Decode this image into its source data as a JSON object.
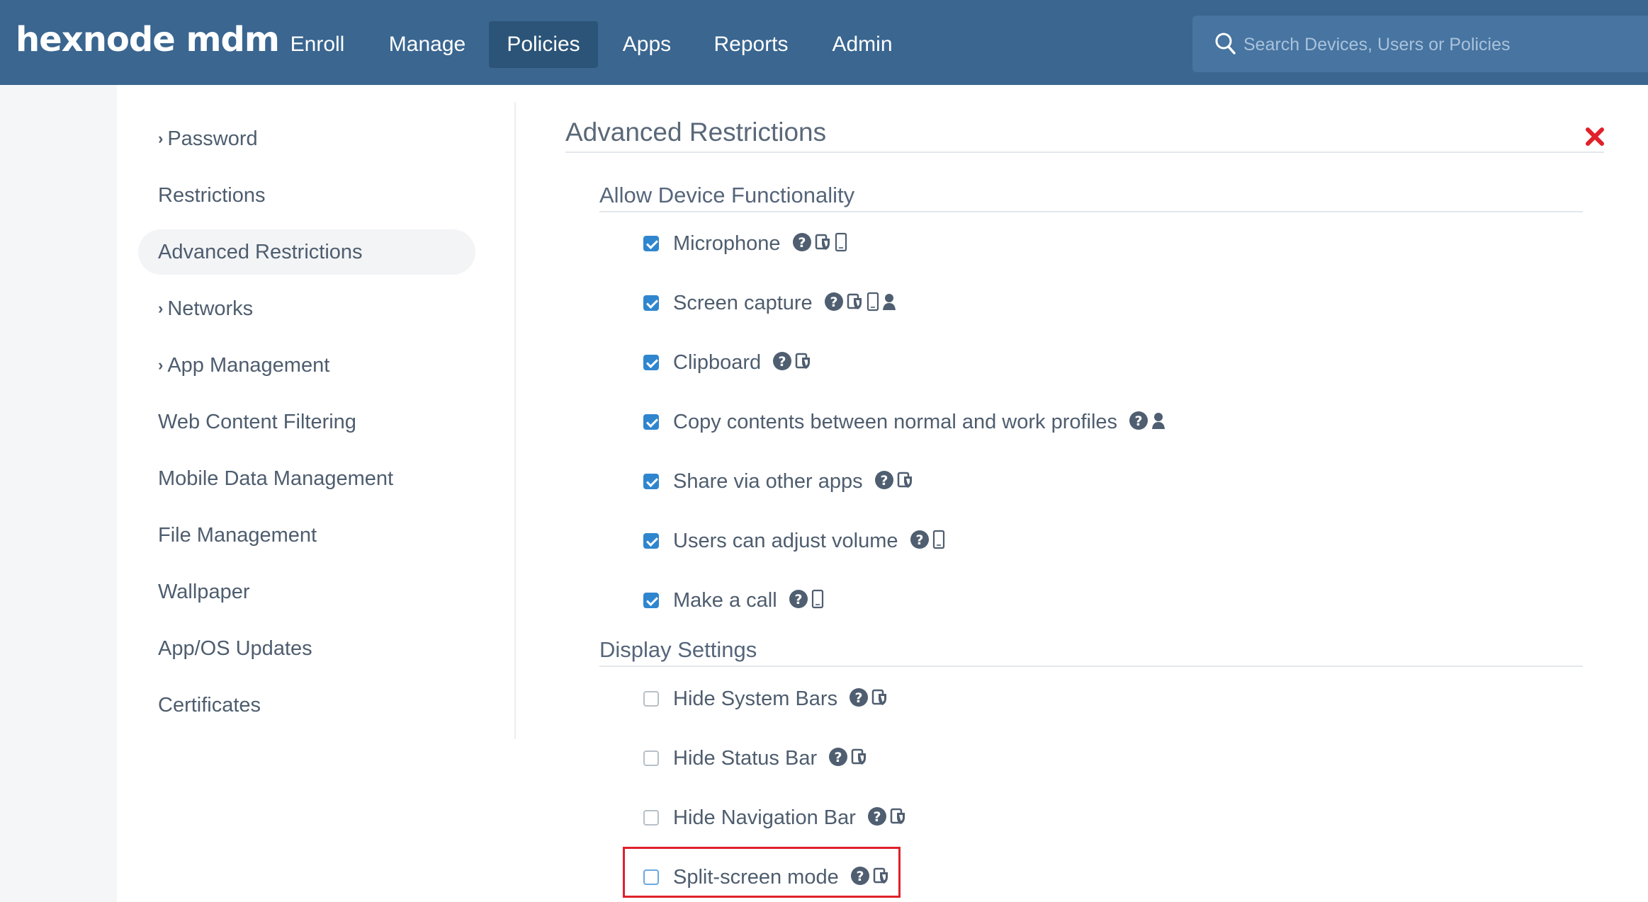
{
  "header": {
    "logo": "hexnode mdm",
    "nav": [
      {
        "label": "Enroll"
      },
      {
        "label": "Manage"
      },
      {
        "label": "Policies"
      },
      {
        "label": "Apps"
      },
      {
        "label": "Reports"
      },
      {
        "label": "Admin"
      }
    ],
    "active_nav": "Policies",
    "search_placeholder": "Search Devices, Users or Policies"
  },
  "sidebar": {
    "items": [
      {
        "label": "Password",
        "expandable": true
      },
      {
        "label": "Restrictions",
        "expandable": false
      },
      {
        "label": "Advanced Restrictions",
        "expandable": false,
        "active": true
      },
      {
        "label": "Networks",
        "expandable": true
      },
      {
        "label": "App Management",
        "expandable": true
      },
      {
        "label": "Web Content Filtering",
        "expandable": false
      },
      {
        "label": "Mobile Data Management",
        "expandable": false
      },
      {
        "label": "File Management",
        "expandable": false
      },
      {
        "label": "Wallpaper",
        "expandable": false
      },
      {
        "label": "App/OS Updates",
        "expandable": false
      },
      {
        "label": "Certificates",
        "expandable": false
      }
    ]
  },
  "main": {
    "title": "Advanced Restrictions",
    "sections": [
      {
        "title": "Allow Device Functionality",
        "options": [
          {
            "label": "Microphone",
            "checked": true,
            "icons": [
              "help-icon",
              "shield-icon",
              "device-icon"
            ]
          },
          {
            "label": "Screen capture",
            "checked": true,
            "icons": [
              "help-icon",
              "shield-icon",
              "device-icon",
              "user-icon"
            ]
          },
          {
            "label": "Clipboard",
            "checked": true,
            "icons": [
              "help-icon",
              "shield-icon"
            ]
          },
          {
            "label": "Copy contents between normal and work profiles",
            "checked": true,
            "icons": [
              "help-icon",
              "user-icon"
            ]
          },
          {
            "label": "Share via other apps",
            "checked": true,
            "icons": [
              "help-icon",
              "shield-icon"
            ]
          },
          {
            "label": "Users can adjust volume",
            "checked": true,
            "icons": [
              "help-icon",
              "device-icon"
            ]
          },
          {
            "label": "Make a call",
            "checked": true,
            "icons": [
              "help-icon",
              "device-icon"
            ]
          }
        ]
      },
      {
        "title": "Display Settings",
        "options": [
          {
            "label": "Hide System Bars",
            "checked": false,
            "icons": [
              "help-icon",
              "shield-icon"
            ]
          },
          {
            "label": "Hide Status Bar",
            "checked": false,
            "icons": [
              "help-icon",
              "shield-icon"
            ]
          },
          {
            "label": "Hide Navigation Bar",
            "checked": false,
            "icons": [
              "help-icon",
              "shield-icon"
            ]
          },
          {
            "label": "Split-screen mode",
            "checked": false,
            "highlighted": true,
            "icons": [
              "help-icon",
              "shield-icon"
            ]
          }
        ]
      }
    ]
  },
  "colors": {
    "topbar": "#3a6690",
    "nav_active": "#2c5478",
    "checkbox_checked": "#2f86cf",
    "highlight": "#e0212b",
    "close": "#e0212b"
  }
}
